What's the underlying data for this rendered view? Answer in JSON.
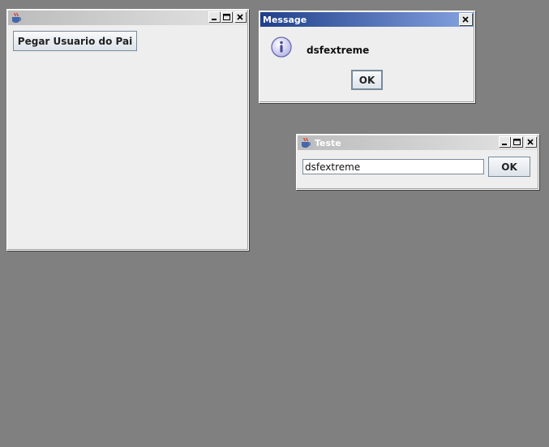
{
  "main_window": {
    "title": "",
    "action_button_label": "Pegar Usuario do Pai"
  },
  "message_dialog": {
    "title": "Message",
    "message_text": "dsfextreme",
    "ok_label": "OK"
  },
  "teste_window": {
    "title": "Teste",
    "input_value": "dsfextreme",
    "ok_label": "OK"
  },
  "icons": {
    "app_icon": "java-cup-icon",
    "info_icon": "information-icon"
  },
  "colors": {
    "desktop": "#808080",
    "active_title": "#1f3f8a",
    "inactive_title": "#bcbcbc"
  }
}
